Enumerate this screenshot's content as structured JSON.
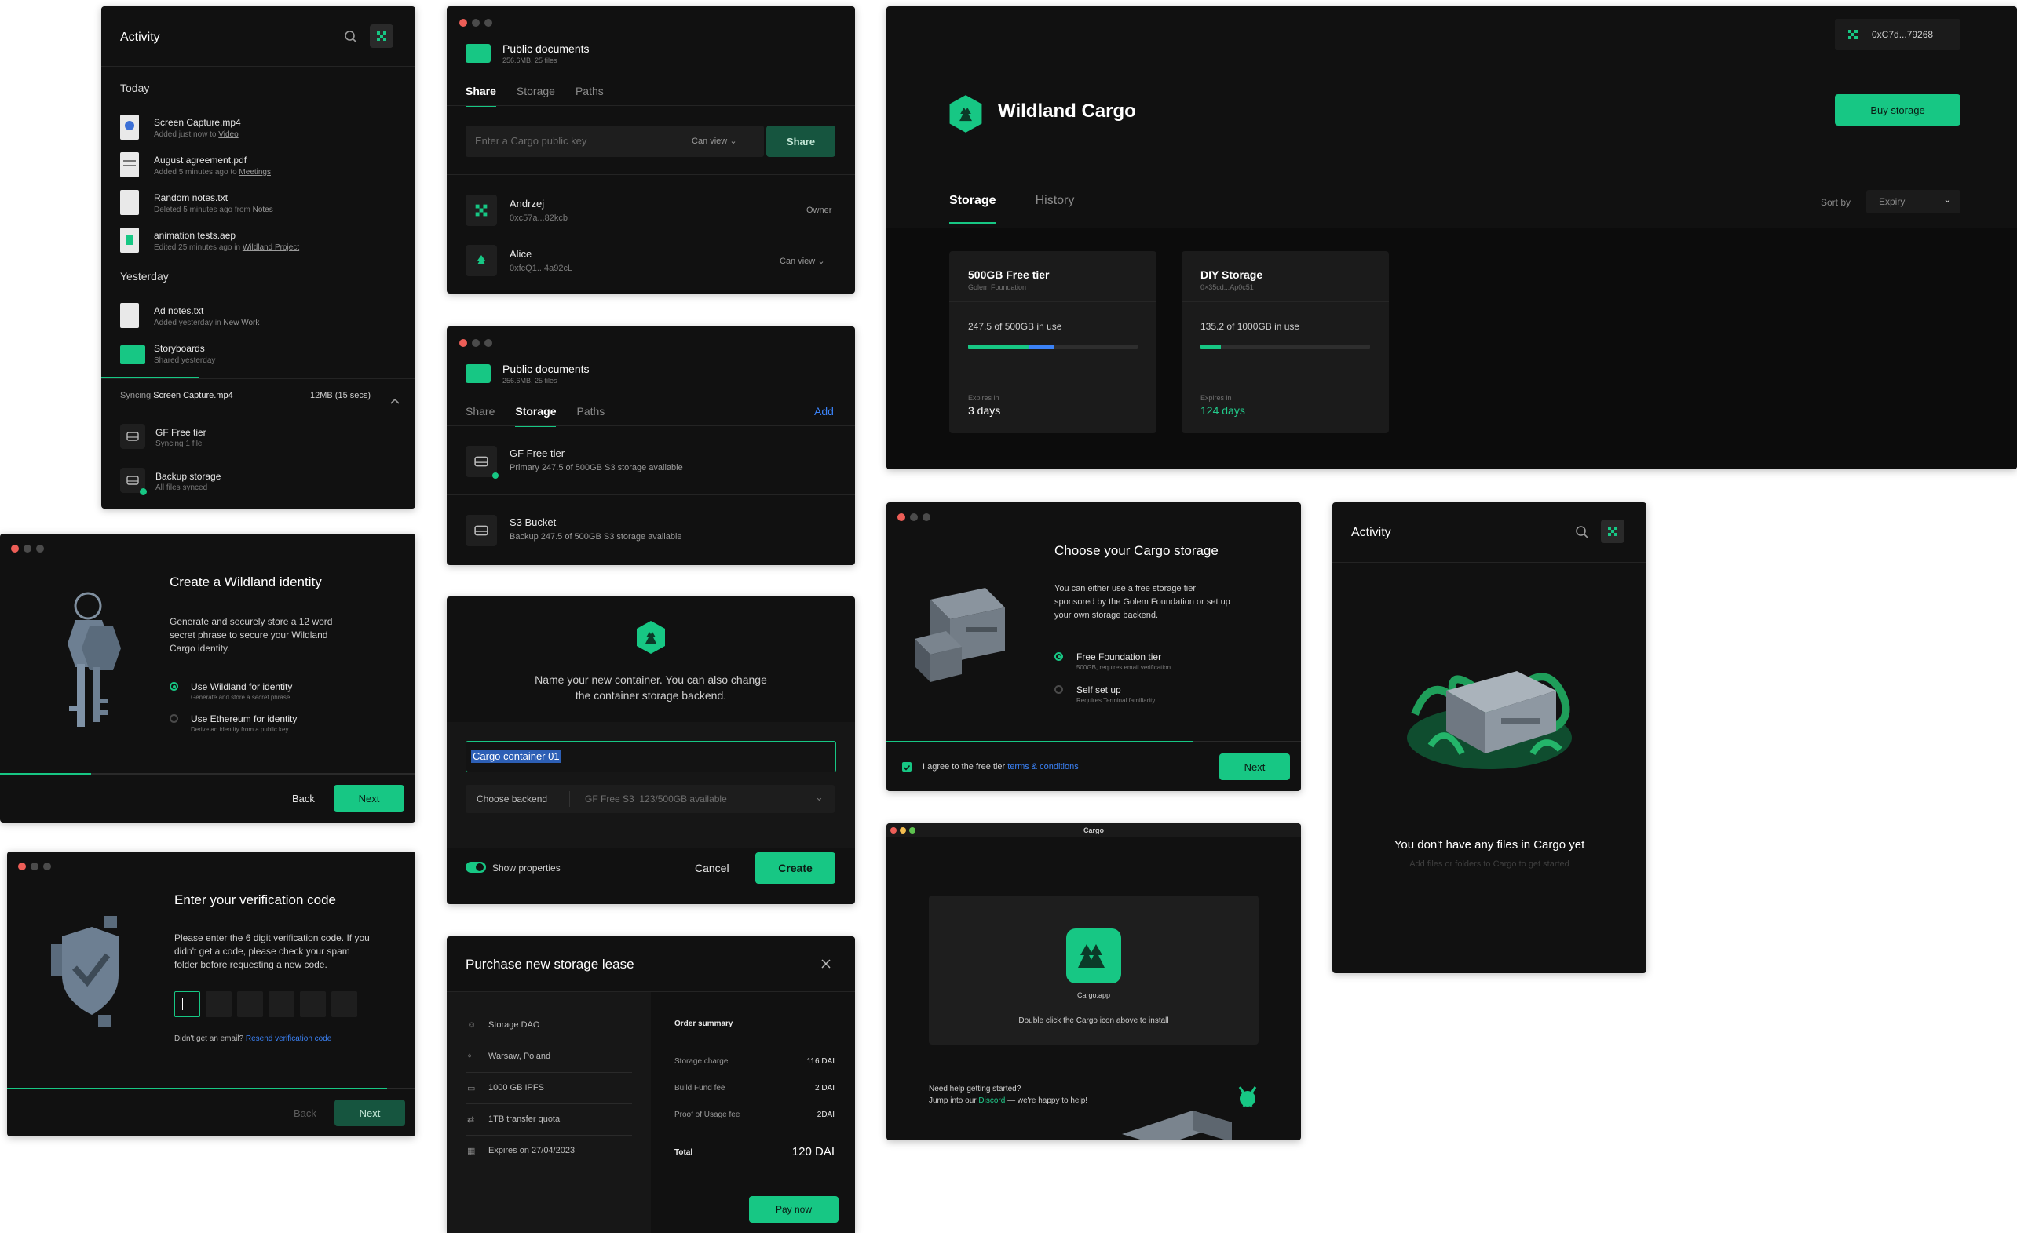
{
  "colors": {
    "accent": "#17c784",
    "panel": "#111111",
    "blue": "#3b82f6"
  },
  "activity1": {
    "title": "Activity",
    "today": "Today",
    "yesterday": "Yesterday",
    "items_today": [
      {
        "name": "Screen Capture.mp4",
        "sub": "Added just now to",
        "link": "Video"
      },
      {
        "name": "August agreement.pdf",
        "sub": "Added 5 minutes ago to",
        "link": "Meetings"
      },
      {
        "name": "Random notes.txt",
        "sub": "Deleted 5 minutes ago from",
        "link": "Notes"
      },
      {
        "name": "animation tests.aep",
        "sub": "Edited 25 minutes ago in",
        "link": "Wildland Project"
      }
    ],
    "items_yesterday": [
      {
        "name": "Ad notes.txt",
        "sub": "Added yesterday in",
        "link": "New Work"
      },
      {
        "name": "Storyboards",
        "sub": "Shared yesterday",
        "link": ""
      }
    ],
    "sync_prefix": "Syncing",
    "sync_file": "Screen Capture.mp4",
    "sync_size": "12MB (15 secs)",
    "sync_items": [
      {
        "name": "GF Free tier",
        "sub": "Syncing 1 file"
      },
      {
        "name": "Backup storage",
        "sub": "All files synced"
      }
    ]
  },
  "share_panel": {
    "title": "Public documents",
    "sub": "256.6MB, 25 files",
    "tabs": [
      "Share",
      "Storage",
      "Paths"
    ],
    "input_placeholder": "Enter a Cargo public key",
    "can_view": "Can view",
    "share_btn": "Share",
    "users": [
      {
        "name": "Andrzej",
        "key": "0xc57a...82kcb",
        "role": "Owner"
      },
      {
        "name": "Alice",
        "key": "0xfcQ1...4a92cL",
        "role": "Can view"
      }
    ]
  },
  "storage_panel": {
    "title": "Public documents",
    "sub": "256.6MB, 25 files",
    "tabs": [
      "Share",
      "Storage",
      "Paths"
    ],
    "add": "Add",
    "items": [
      {
        "name": "GF Free tier",
        "sub": "Primary 247.5 of 500GB S3 storage available"
      },
      {
        "name": "S3 Bucket",
        "sub": "Backup 247.5 of 500GB S3 storage available"
      }
    ]
  },
  "container_panel": {
    "text": "Name your new container. You can also change the container storage backend.",
    "input_value": "Cargo container 01",
    "backend_label": "Choose backend",
    "backend_value": "GF Free S3",
    "backend_avail": "123/500GB available",
    "toggle_label": "Show properties",
    "cancel": "Cancel",
    "create": "Create"
  },
  "purchase_panel": {
    "title": "Purchase new storage lease",
    "left": [
      "Storage DAO",
      "Warsaw, Poland",
      "1000 GB IPFS",
      "1TB transfer quota",
      "Expires on 27/04/2023"
    ],
    "summary_title": "Order summary",
    "rows": [
      {
        "label": "Storage charge",
        "value": "116 DAI"
      },
      {
        "label": "Build Fund fee",
        "value": "2 DAI"
      },
      {
        "label": "Proof of Usage fee",
        "value": "2DAI"
      }
    ],
    "total_label": "Total",
    "total_value": "120 DAI",
    "pay": "Pay now"
  },
  "identity_panel": {
    "title": "Create a Wildland identity",
    "text": "Generate and securely store a 12 word secret phrase to secure your Wildland Cargo identity.",
    "options": [
      {
        "label": "Use Wildland for identity",
        "sub": "Generate and store a secret phrase"
      },
      {
        "label": "Use Ethereum for identity",
        "sub": "Derive an identity from a public key"
      }
    ],
    "progress": 0.22,
    "back": "Back",
    "next": "Next"
  },
  "verify_panel": {
    "title": "Enter your verification code",
    "text": "Please enter the 6 digit verification code. If you didn't get a code, please check your spam folder before requesting a new code.",
    "prompt": "Didn't get an email?",
    "resend": "Resend verification code",
    "progress": 0.93,
    "back": "Back",
    "next": "Next"
  },
  "wildland_panel": {
    "address": "0xC7d...79268",
    "brand": "Wildland Cargo",
    "buy": "Buy storage",
    "tabs": [
      "Storage",
      "History"
    ],
    "sort_label": "Sort by",
    "sort_value": "Expiry",
    "cards": [
      {
        "title": "500GB Free tier",
        "sub": "Golem Foundation",
        "usage": "247.5 of 500GB in use",
        "fill_green": 0.36,
        "fill_blue": 0.15,
        "expires_label": "Expires in",
        "expires": "3 days"
      },
      {
        "title": "DIY Storage",
        "sub": "0×35cd...Ap0c51",
        "usage": "135.2 of 1000GB in use",
        "fill_green": 0.12,
        "fill_blue": 0,
        "expires_label": "Expires in",
        "expires": "124 days"
      }
    ]
  },
  "choose_panel": {
    "title": "Choose your Cargo storage",
    "text": "You can either use a free storage tier sponsored by the Golem Foundation or set up your own storage backend.",
    "options": [
      {
        "label": "Free Foundation tier",
        "sub": "500GB, requires email verification"
      },
      {
        "label": "Self set up",
        "sub": "Requires Terminal familiarity"
      }
    ],
    "agree_prefix": "I agree to the free tier",
    "agree_link": "terms & conditions",
    "progress": 0.74,
    "next": "Next"
  },
  "install_panel": {
    "window_title": "Cargo",
    "app_name": "Cargo.app",
    "instruction": "Double click the Cargo icon above to install",
    "help1": "Need help getting started?",
    "help2_prefix": "Jump into our",
    "discord": "Discord",
    "help2_suffix": "— we're happy to help!"
  },
  "activity2": {
    "title": "Activity",
    "empty_title": "You don't have any files in Cargo yet",
    "empty_sub": "Add files or folders to Cargo to get started"
  }
}
